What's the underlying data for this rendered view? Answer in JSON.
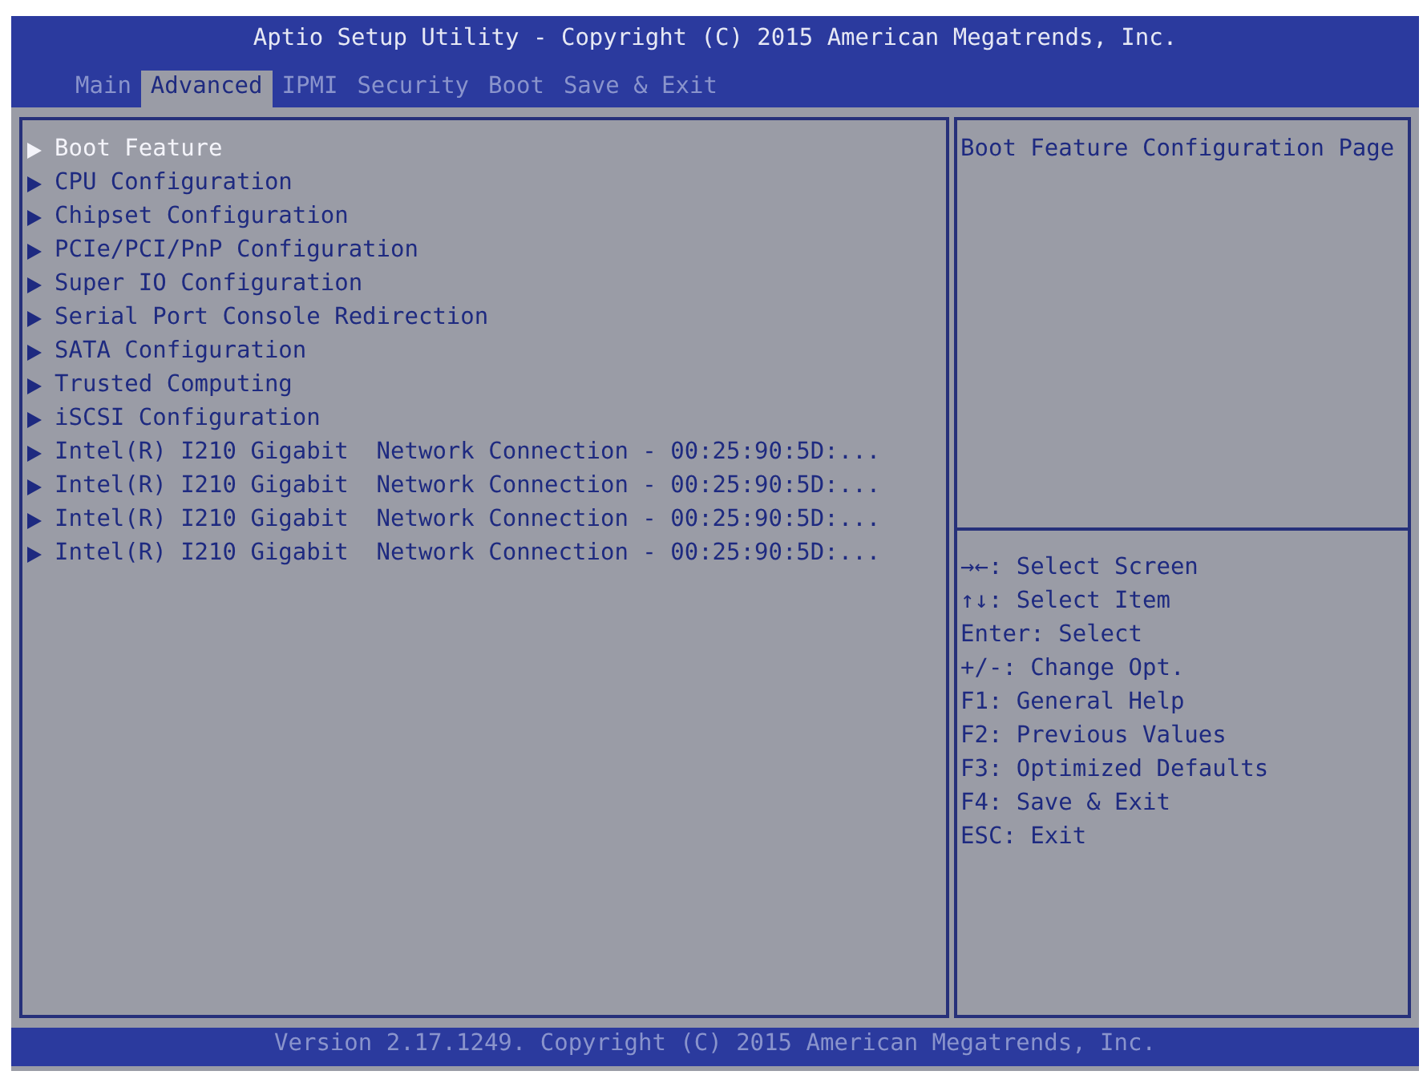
{
  "window": {
    "title": "Aptio Setup Utility - Copyright (C) 2015 American Megatrends, Inc."
  },
  "tabs": [
    {
      "label": "Main",
      "selected": false
    },
    {
      "label": "Advanced",
      "selected": true
    },
    {
      "label": "IPMI",
      "selected": false
    },
    {
      "label": "Security",
      "selected": false
    },
    {
      "label": "Boot",
      "selected": false
    },
    {
      "label": "Save & Exit",
      "selected": false
    }
  ],
  "menu": [
    {
      "label": "Boot Feature",
      "selected": true
    },
    {
      "label": "CPU Configuration",
      "selected": false
    },
    {
      "label": "Chipset Configuration",
      "selected": false
    },
    {
      "label": "PCIe/PCI/PnP Configuration",
      "selected": false
    },
    {
      "label": "Super IO Configuration",
      "selected": false
    },
    {
      "label": "Serial Port Console Redirection",
      "selected": false
    },
    {
      "label": "SATA Configuration",
      "selected": false
    },
    {
      "label": "Trusted Computing",
      "selected": false
    },
    {
      "label": "iSCSI Configuration",
      "selected": false
    },
    {
      "label": "Intel(R) I210 Gigabit  Network Connection - 00:25:90:5D:...",
      "selected": false
    },
    {
      "label": "Intel(R) I210 Gigabit  Network Connection - 00:25:90:5D:...",
      "selected": false
    },
    {
      "label": "Intel(R) I210 Gigabit  Network Connection - 00:25:90:5D:...",
      "selected": false
    },
    {
      "label": "Intel(R) I210 Gigabit  Network Connection - 00:25:90:5D:...",
      "selected": false
    }
  ],
  "help": {
    "description": "Boot Feature Configuration Page",
    "keys": [
      "→←: Select Screen",
      "↑↓: Select Item",
      "Enter: Select",
      "+/-: Change Opt.",
      "F1: General Help",
      "F2: Previous Values",
      "F3: Optimized Defaults",
      "F4: Save & Exit",
      "ESC: Exit"
    ]
  },
  "status_bar": "Version 2.17.1249. Copyright (C) 2015 American Megatrends, Inc."
}
